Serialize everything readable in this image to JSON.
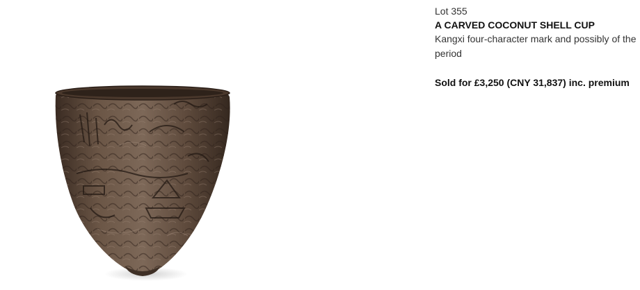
{
  "lot": {
    "label": "Lot 355",
    "title": "A CARVED COCONUT SHELL CUP",
    "description": "Kangxi four-character mark and possibly of the period",
    "sold": "Sold for £3,250 (CNY 31,837) inc. premium"
  },
  "image": {
    "subject": "carved-coconut-shell-cup",
    "colors": {
      "body": "#5e4a3c",
      "dark": "#3a2b22",
      "highlight": "#8a7566",
      "background": "#ffffff"
    }
  }
}
